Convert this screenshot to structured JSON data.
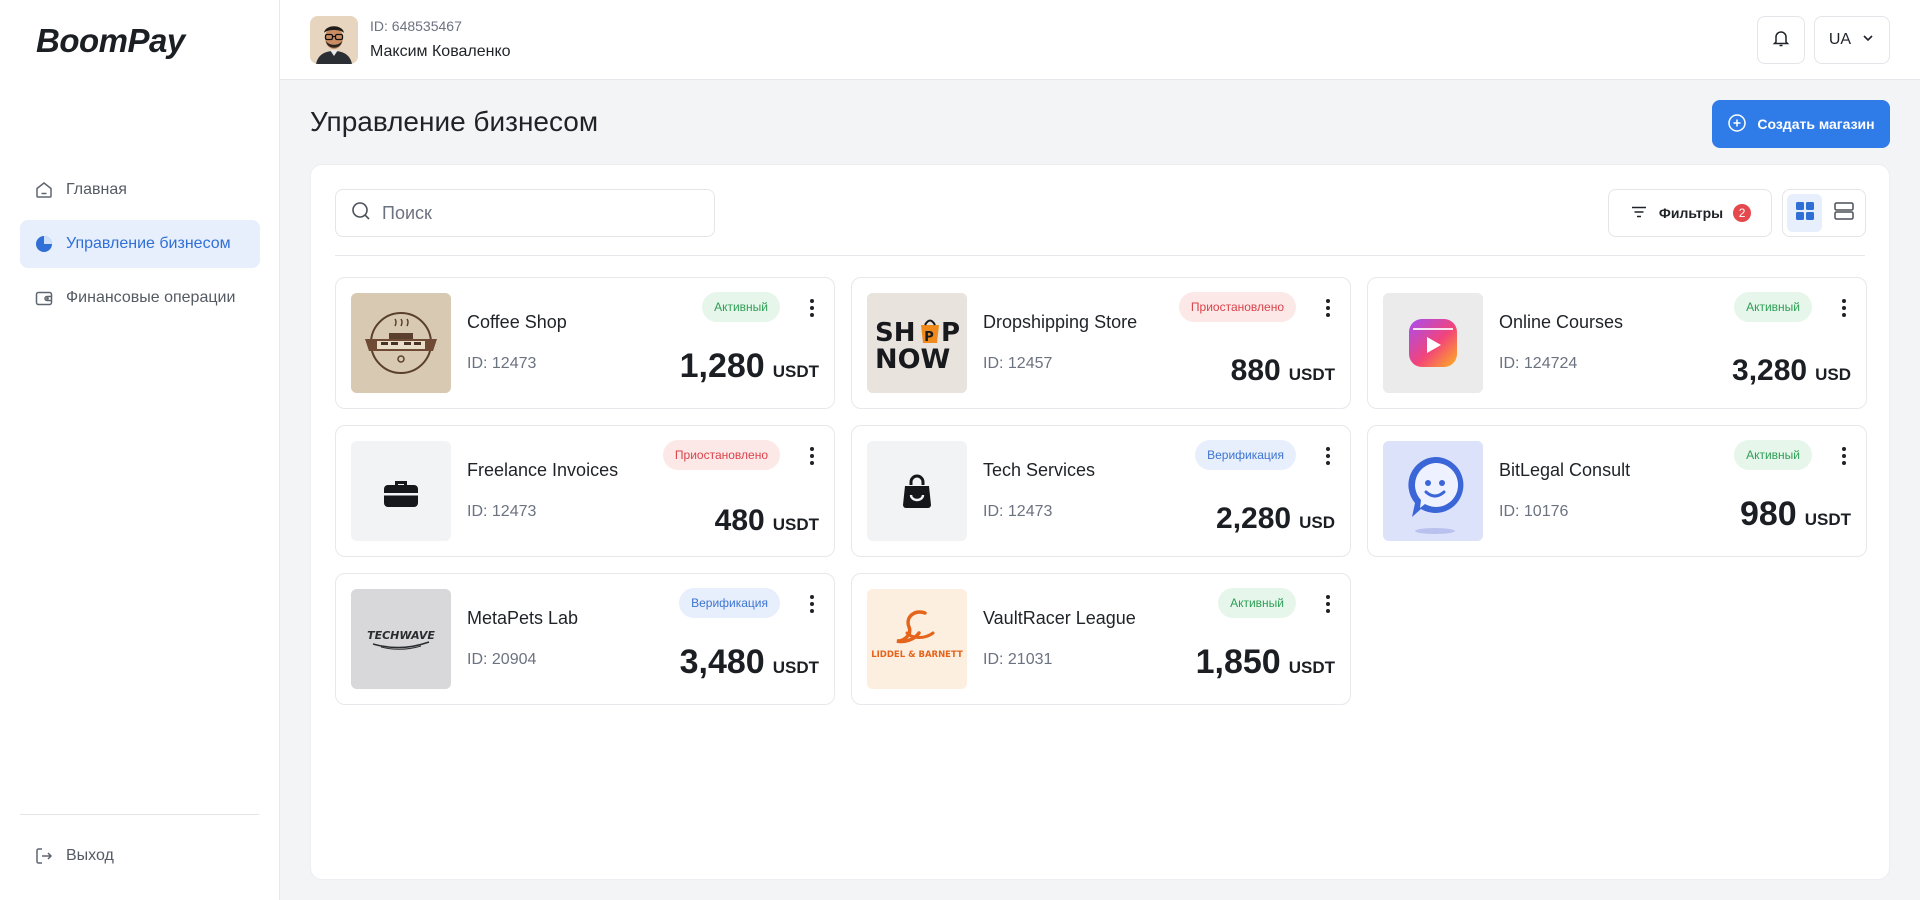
{
  "brand": {
    "logo": "BoomPay"
  },
  "sidebar": {
    "items": [
      {
        "label": "Главная",
        "icon": "home-icon",
        "active": false
      },
      {
        "label": "Управление бизнесом",
        "icon": "pie-chart-icon",
        "active": true
      },
      {
        "label": "Финансовые операции",
        "icon": "wallet-icon",
        "active": false
      }
    ],
    "logout_label": "Выход"
  },
  "header": {
    "user_id": "ID: 648535467",
    "user_name": "Максим Коваленко",
    "language": "UA"
  },
  "page": {
    "title": "Управление бизнесом",
    "create_button": "Создать магазин"
  },
  "toolbar": {
    "search_placeholder": "Поиск",
    "search_value": "",
    "filters_label": "Фильтры",
    "filters_count": "2",
    "view_mode": "grid"
  },
  "stores": [
    {
      "name": "Coffee Shop",
      "id": "ID: 12473",
      "status": "Активный",
      "status_type": "active",
      "amount": "1,280",
      "currency": "USDT",
      "logo": "coffee-cofe-logo"
    },
    {
      "name": "Dropshipping Store",
      "id": "ID: 12457",
      "status": "Приостановлено",
      "status_type": "paused",
      "amount": "880",
      "currency": "USDT",
      "logo": "shop-now-logo",
      "logo_text": [
        "SH",
        "P",
        "NOW"
      ]
    },
    {
      "name": "Online Courses",
      "id": "ID: 124724",
      "status": "Активный",
      "status_type": "active",
      "amount": "3,280",
      "currency": "USD",
      "logo": "video-play-logo"
    },
    {
      "name": "Freelance Invoices",
      "id": "ID: 12473",
      "status": "Приостановлено",
      "status_type": "paused",
      "amount": "480",
      "currency": "USDT",
      "logo": "briefcase-icon"
    },
    {
      "name": "Tech Services",
      "id": "ID: 12473",
      "status": "Верификация",
      "status_type": "verify",
      "amount": "2,280",
      "currency": "USD",
      "logo": "shopping-bag-icon"
    },
    {
      "name": "BitLegal Consult",
      "id": "ID: 10176",
      "status": "Активный",
      "status_type": "active",
      "amount": "980",
      "currency": "USDT",
      "logo": "chat-smile-logo"
    },
    {
      "name": "MetaPets Lab",
      "id": "ID: 20904",
      "status": "Верификация",
      "status_type": "verify",
      "amount": "3,480",
      "currency": "USDT",
      "logo": "techwave-logo",
      "logo_text": "TECHWAVE"
    },
    {
      "name": "VaultRacer League",
      "id": "ID: 21031",
      "status": "Активный",
      "status_type": "active",
      "amount": "1,850",
      "currency": "USDT",
      "logo": "liddel-barnett-logo",
      "logo_text": "LIDDEL & BARNETT"
    }
  ],
  "colors": {
    "accent": "#2f7be8",
    "active_bg": "#e6f6ea",
    "active_text": "#2f9e57",
    "paused_bg": "#fde8e8",
    "paused_text": "#d9434a",
    "verify_bg": "#e7effc",
    "verify_text": "#3d74d1"
  }
}
